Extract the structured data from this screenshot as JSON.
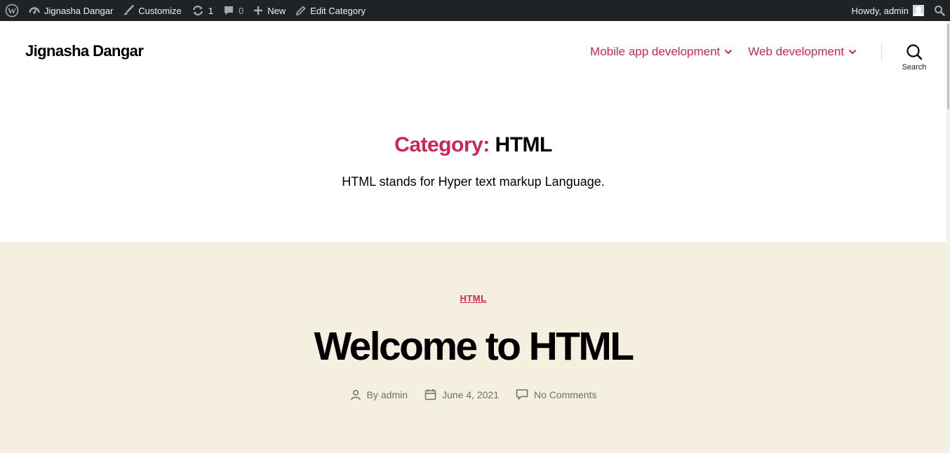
{
  "admin_bar": {
    "site_name": "Jignasha Dangar",
    "customize": "Customize",
    "updates_count": "1",
    "comments_count": "0",
    "new_label": "New",
    "edit_label": "Edit Category",
    "howdy": "Howdy, admin",
    "icons": [
      "wordpress-icon",
      "dashboard-icon",
      "brush-icon",
      "updates-icon",
      "comment-icon",
      "plus-icon",
      "pencil-icon",
      "avatar",
      "search-icon"
    ]
  },
  "header": {
    "site_title": "Jignasha Dangar",
    "menu": [
      {
        "label": "Mobile app development"
      },
      {
        "label": "Web development"
      }
    ],
    "search_label": "Search"
  },
  "archive": {
    "prefix": "Category:",
    "name": "HTML",
    "description": "HTML stands for Hyper text markup Language."
  },
  "post": {
    "category": "HTML",
    "title": "Welcome to HTML",
    "author_prefix": "By",
    "author": "admin",
    "date": "June 4, 2021",
    "comments": "No Comments"
  },
  "colors": {
    "accent": "#cd2653",
    "admin_bar_bg": "#1d2327",
    "post_bg": "#f5efe0",
    "meta_text": "#6d6d6d"
  }
}
